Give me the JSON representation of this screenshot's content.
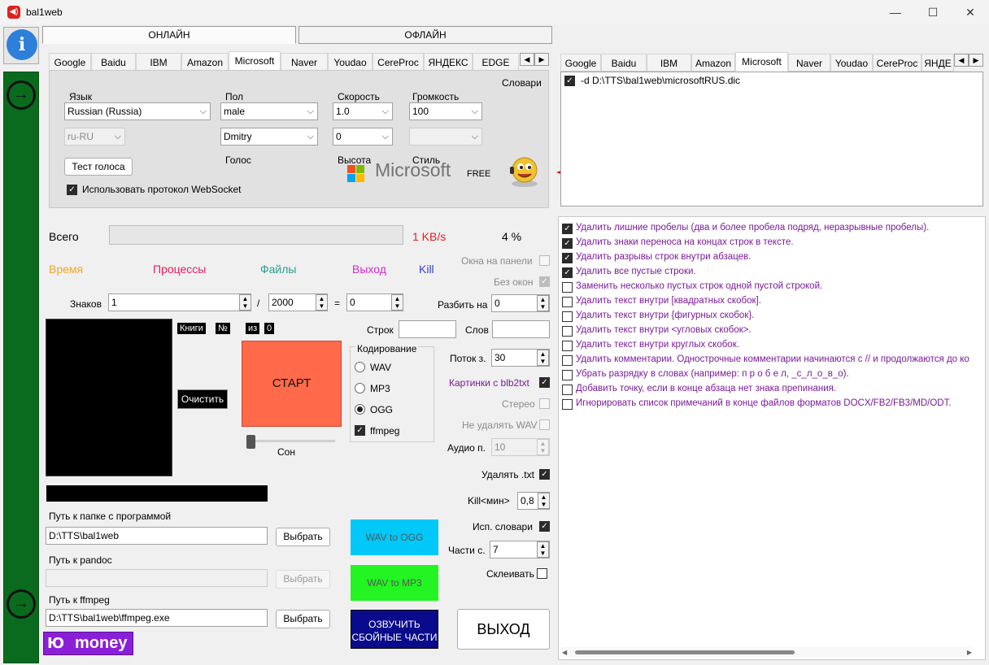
{
  "window": {
    "title": "bal1web",
    "minimize": "—",
    "maximize": "☐",
    "close": "✕"
  },
  "mode": {
    "online": "ОНЛАЙН",
    "offline": "ОФЛАЙН"
  },
  "left_tabs": [
    "Google",
    "Baidu",
    "IBM",
    "Amazon",
    "Microsoft",
    "Naver",
    "Youdao",
    "CereProc",
    "ЯНДЕКС",
    "EDGE"
  ],
  "right_tabs": [
    "Google",
    "Baidu",
    "IBM",
    "Amazon",
    "Microsoft",
    "Naver",
    "Youdao",
    "CereProc",
    "ЯНДЕ"
  ],
  "voice": {
    "lang_label": "Язык",
    "lang_value": "Russian (Russia)",
    "lang_code": "ru-RU",
    "gender_label": "Пол",
    "gender_value": "male",
    "voice_value": "Dmitry",
    "voice_label": "Голос",
    "speed_label": "Скорость",
    "speed_value": "1.0",
    "pitch_value": "0",
    "pitch_label": "Высота",
    "volume_label": "Громкость",
    "volume_value": "100",
    "style_label": "Стиль",
    "dictionaries_label": "Словари",
    "test_button": "Тест голоса",
    "websocket_label": "Использовать протокол WebSocket",
    "brand": "Microsoft",
    "free": "FREE"
  },
  "progress": {
    "total_label": "Всего",
    "speed": "1 KB/s",
    "percent": "4 %",
    "fraction": 0.0
  },
  "sections": {
    "time": "Время",
    "processes": "Процессы",
    "files": "Файлы",
    "output": "Выход",
    "kill": "Kill"
  },
  "chars": {
    "label": "Знаков",
    "from": "1",
    "slash": "/",
    "to": "2000",
    "eq": "=",
    "result": "0"
  },
  "books": {
    "label": "Книги",
    "num": "№",
    "of": "из",
    "count": "0"
  },
  "clear_button": "Очистить",
  "start_button": "СТАРТ",
  "sleep_label": "Сон",
  "lines_label": "Строк",
  "words_label": "Слов",
  "encoding": {
    "title": "Кодирование",
    "options": [
      "WAV",
      "MP3",
      "OGG"
    ],
    "selected": "OGG",
    "ffmpeg": "ffmpeg"
  },
  "right_controls": {
    "tray": "Окна на панели",
    "no_windows": "Без окон",
    "split_label": "Разбить на",
    "split_value": "0",
    "threads_label": "Поток з.",
    "threads_value": "30",
    "pictures_label": "Картинки с  blb2txt",
    "stereo_label": "Стерео",
    "keep_wav_label": "Не удалять WAV",
    "audio_label": "Аудио п.",
    "audio_value": "10",
    "delete_txt_label": "Удалять .txt",
    "kill_label": "Kill<мин>",
    "kill_value": "0,8",
    "dict_label": "Исп. словари",
    "parts_label": "Части с.",
    "parts_value": "7",
    "glue_label": "Склеивать"
  },
  "paths": {
    "program_label": "Путь к папке с программой",
    "program_value": "D:\\TTS\\bal1web",
    "pandoc_label": "Путь к pandoc",
    "pandoc_value": "",
    "ffmpeg_label": "Путь к ffmpeg",
    "ffmpeg_value": "D:\\TTS\\bal1web\\ffmpeg.exe",
    "choose": "Выбрать"
  },
  "convert": {
    "wav_ogg": "WAV to OGG",
    "wav_mp3": "WAV to MP3",
    "voice_failed_1": "ОЗВУЧИТЬ",
    "voice_failed_2": "СБОЙНЫЕ ЧАСТИ",
    "exit": "ВЫХОД"
  },
  "money": "money",
  "dictionary_file": "-d D:\\TTS\\bal1web\\microsoftRUS.dic",
  "text_options": [
    {
      "label": "Удалить лишние пробелы (два и более пробела подряд, неразрывные пробелы).",
      "checked": true
    },
    {
      "label": "Удалить знаки переноса на концах строк в тексте.",
      "checked": true
    },
    {
      "label": "Удалить разрывы строк внутри абзацев.",
      "checked": true
    },
    {
      "label": "Удалить все пустые строки.",
      "checked": true
    },
    {
      "label": "Заменить несколько пустых строк одной пустой строкой.",
      "checked": false
    },
    {
      "label": "Удалить текст внутри [квадратных скобок].",
      "checked": false
    },
    {
      "label": "Удалить текст внутри {фигурных скобок}.",
      "checked": false
    },
    {
      "label": "Удалить текст внутри <угловых скобок>.",
      "checked": false
    },
    {
      "label": "Удалить текст внутри круглых скобок.",
      "checked": false
    },
    {
      "label": "Удалить комментарии. Однострочные комментарии начинаются с // и продолжаются до ко",
      "checked": false
    },
    {
      "label": "Убрать разрядку в словах (например: п р о б е л, _с_л_о_в_о).",
      "checked": false
    },
    {
      "label": "Добавить точку, если в конце абзаца нет знака препинания.",
      "checked": false
    },
    {
      "label": "Игнорировать список примечаний в конце файлов форматов DOCX/FB2/FB3/MD/ODT.",
      "checked": false
    }
  ],
  "colors": {
    "accent_green": "#0a6b1e",
    "start": "#ff6a4a",
    "wav_ogg": "#00c8f8",
    "wav_mp3": "#22f522",
    "failed": "#0a0a8c",
    "money": "#8b1fd8",
    "arrow": "#e01010"
  }
}
